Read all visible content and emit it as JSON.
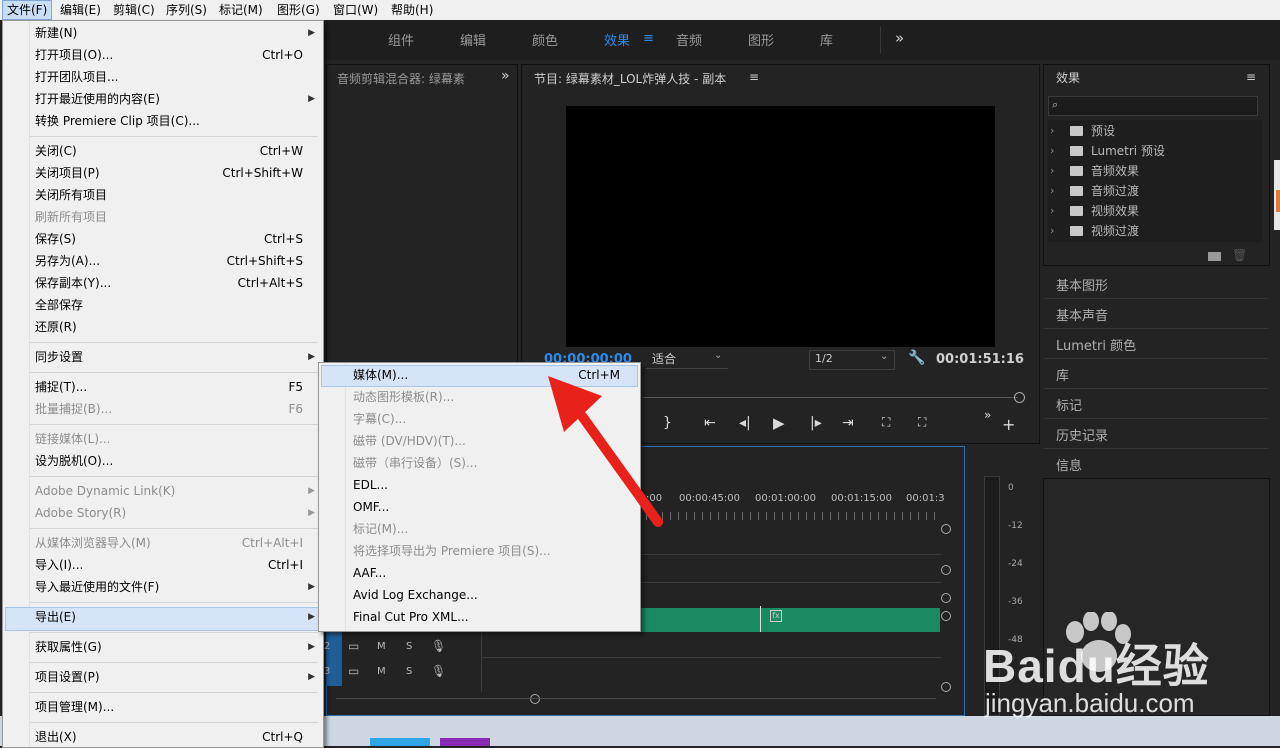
{
  "menubar": [
    "文件(F)",
    "编辑(E)",
    "剪辑(C)",
    "序列(S)",
    "标记(M)",
    "图形(G)",
    "窗口(W)",
    "帮助(H)"
  ],
  "workspace_tabs": [
    "组件",
    "编辑",
    "颜色",
    "效果",
    "音频",
    "图形",
    "库"
  ],
  "workspace_more": "»",
  "audio_mixer": {
    "title": "音频剪辑混合器: 绿幕素",
    "more": "»"
  },
  "program": {
    "title": "节目: 绿幕素材_LOL炸弹人技 - 副本",
    "timecode": "00:00:00:00",
    "fit": "适合",
    "res": "1/2",
    "duration": "00:01:51:16"
  },
  "effects": {
    "title": "效果",
    "folders": [
      "预设",
      "Lumetri 预设",
      "音频效果",
      "音频过渡",
      "视频效果",
      "视频过渡"
    ]
  },
  "right_panels": [
    "基本图形",
    "基本声音",
    "Lumetri 颜色",
    "库",
    "标记",
    "历史记录",
    "信息"
  ],
  "timeline": {
    "ruler": [
      ":00",
      "00:00:45:00",
      "00:01:00:00",
      "00:01:15:00",
      "00:01:3"
    ],
    "tracks": [
      {
        "id": "2",
        "m": "M",
        "s": "S"
      },
      {
        "id": "3",
        "m": "M",
        "s": "S"
      }
    ]
  },
  "meter": [
    "0",
    "-12",
    "-24",
    "-36",
    "-48"
  ],
  "file_menu": [
    {
      "label": "新建(N)",
      "sub": true
    },
    {
      "label": "打开项目(O)...",
      "shortcut": "Ctrl+O"
    },
    {
      "label": "打开团队项目..."
    },
    {
      "label": "打开最近使用的内容(E)",
      "sub": true
    },
    {
      "label": "转换 Premiere Clip 项目(C)..."
    },
    {
      "label": "关闭(C)",
      "shortcut": "Ctrl+W"
    },
    {
      "label": "关闭项目(P)",
      "shortcut": "Ctrl+Shift+W"
    },
    {
      "label": "关闭所有项目"
    },
    {
      "label": "刷新所有项目",
      "disabled": true
    },
    {
      "label": "保存(S)",
      "shortcut": "Ctrl+S"
    },
    {
      "label": "另存为(A)...",
      "shortcut": "Ctrl+Shift+S"
    },
    {
      "label": "保存副本(Y)...",
      "shortcut": "Ctrl+Alt+S"
    },
    {
      "label": "全部保存"
    },
    {
      "label": "还原(R)"
    },
    {
      "label": "同步设置",
      "sub": true
    },
    {
      "label": "捕捉(T)...",
      "shortcut": "F5"
    },
    {
      "label": "批量捕捉(B)...",
      "shortcut": "F6",
      "disabled": true
    },
    {
      "label": "链接媒体(L)...",
      "disabled": true
    },
    {
      "label": "设为脱机(O)..."
    },
    {
      "label": "Adobe Dynamic Link(K)",
      "sub": true,
      "disabled": true
    },
    {
      "label": "Adobe Story(R)",
      "sub": true,
      "disabled": true
    },
    {
      "label": "从媒体浏览器导入(M)",
      "shortcut": "Ctrl+Alt+I",
      "disabled": true
    },
    {
      "label": "导入(I)...",
      "shortcut": "Ctrl+I"
    },
    {
      "label": "导入最近使用的文件(F)",
      "sub": true
    },
    {
      "label": "导出(E)",
      "sub": true
    },
    {
      "label": "获取属性(G)",
      "sub": true
    },
    {
      "label": "项目设置(P)",
      "sub": true
    },
    {
      "label": "项目管理(M)..."
    },
    {
      "label": "退出(X)",
      "shortcut": "Ctrl+Q"
    }
  ],
  "export_menu": [
    {
      "label": "媒体(M)...",
      "shortcut": "Ctrl+M"
    },
    {
      "label": "动态图形模板(R)...",
      "disabled": true
    },
    {
      "label": "字幕(C)...",
      "disabled": true
    },
    {
      "label": "磁带 (DV/HDV)(T)...",
      "disabled": true
    },
    {
      "label": "磁带（串行设备）(S)...",
      "disabled": true
    },
    {
      "label": "EDL..."
    },
    {
      "label": "OMF..."
    },
    {
      "label": "标记(M)...",
      "disabled": true
    },
    {
      "label": "将选择项导出为 Premiere 项目(S)...",
      "disabled": true
    },
    {
      "label": "AAF..."
    },
    {
      "label": "Avid Log Exchange..."
    },
    {
      "label": "Final Cut Pro XML..."
    }
  ],
  "watermark": {
    "brand": "Baidu经验",
    "url": "jingyan.baidu.com"
  },
  "colors": {
    "accent": "#2d8ceb",
    "arrow": "#e8221b",
    "clip": "#1a8a63"
  }
}
